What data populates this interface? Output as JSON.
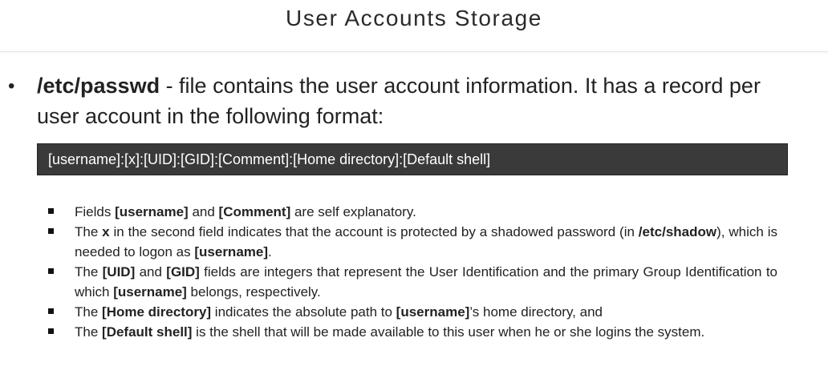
{
  "slide": {
    "title": "User Accounts Storage"
  },
  "main_bullet": {
    "term": "/etc/passwd",
    "text": " - file contains the user account information. It has a record per user account in the following format:"
  },
  "format_box": {
    "text": "[username]:[x]:[UID]:[GID]:[Comment]:[Home directory]:[Default shell]"
  },
  "sub_items": [
    {
      "parts": [
        {
          "t": "Fields ",
          "b": false
        },
        {
          "t": "[username]",
          "b": true
        },
        {
          "t": " and ",
          "b": false
        },
        {
          "t": "[Comment]",
          "b": true
        },
        {
          "t": " are self explanatory.",
          "b": false
        }
      ]
    },
    {
      "parts": [
        {
          "t": "The ",
          "b": false
        },
        {
          "t": "x",
          "b": true
        },
        {
          "t": " in the second field indicates that the account is protected by a shadowed password (in ",
          "b": false
        },
        {
          "t": "/etc/shadow",
          "b": true
        },
        {
          "t": "), which is needed to logon as ",
          "b": false
        },
        {
          "t": "[username]",
          "b": true
        },
        {
          "t": ".",
          "b": false
        }
      ]
    },
    {
      "parts": [
        {
          "t": "The ",
          "b": false
        },
        {
          "t": "[UID]",
          "b": true
        },
        {
          "t": " and ",
          "b": false
        },
        {
          "t": "[GID]",
          "b": true
        },
        {
          "t": " fields are integers that represent the User Identification and the primary Group Identification to which ",
          "b": false
        },
        {
          "t": "[username]",
          "b": true
        },
        {
          "t": " belongs, respectively.",
          "b": false
        }
      ]
    },
    {
      "parts": [
        {
          "t": "The ",
          "b": false
        },
        {
          "t": "[Home directory]",
          "b": true
        },
        {
          "t": " indicates the absolute path to ",
          "b": false
        },
        {
          "t": "[username]",
          "b": true
        },
        {
          "t": "’s home directory, and",
          "b": false
        }
      ]
    },
    {
      "parts": [
        {
          "t": "The ",
          "b": false
        },
        {
          "t": "[Default shell]",
          "b": true
        },
        {
          "t": " is the shell that will be made available to this user when he or she logins the system.",
          "b": false
        }
      ]
    }
  ]
}
